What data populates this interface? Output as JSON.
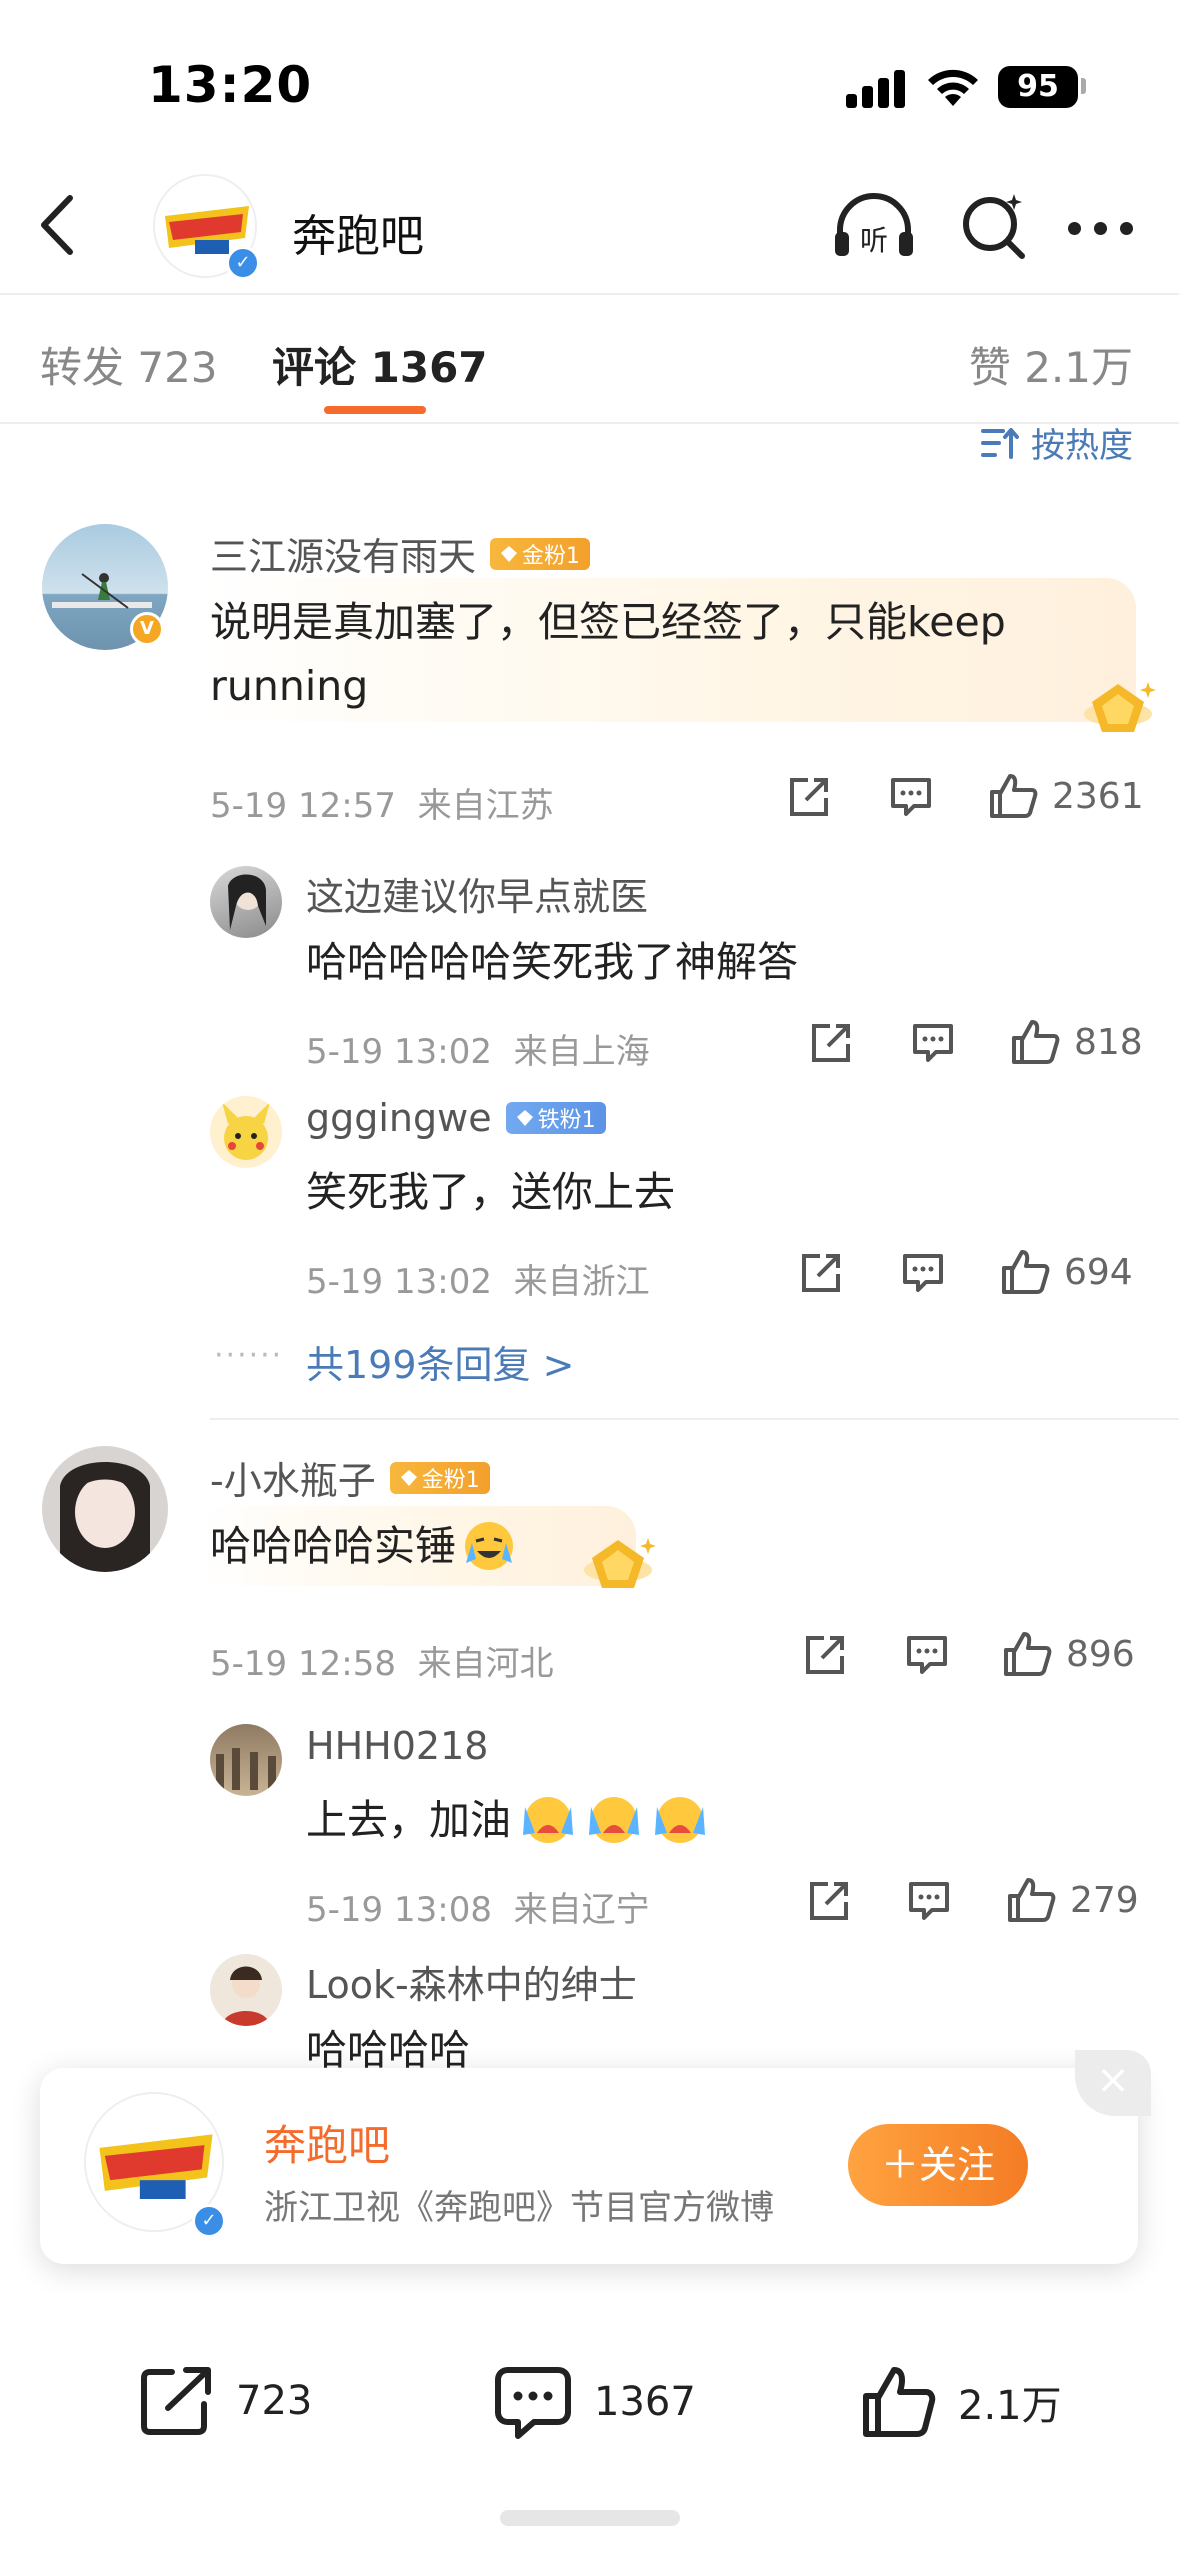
{
  "status": {
    "time": "13:20",
    "battery": "95"
  },
  "nav": {
    "title": "奔跑吧",
    "avatar_text": "奔跑吧"
  },
  "tabs": {
    "repost": "转发 723",
    "comments": "评论 1367",
    "likes": "赞 2.1万"
  },
  "sort": {
    "label": "按热度"
  },
  "comments": [
    {
      "user": "三江源没有雨天",
      "badge": "金粉1",
      "text_line1": "说明是真加塞了，但签已经签了，只能keep",
      "text_line2": "running",
      "time": "5-19 12:57",
      "location": "来自江苏",
      "likes": "2361",
      "replies": [
        {
          "user": "这边建议你早点就医",
          "text": "哈哈哈哈哈笑死我了神解答",
          "time": "5-19 13:02",
          "location": "来自上海",
          "likes": "818"
        },
        {
          "user": "gggingwe",
          "badge": "铁粉1",
          "text": "笑死我了，送你上去",
          "time": "5-19 13:02",
          "location": "来自浙江",
          "likes": "694"
        }
      ],
      "more_replies": "共199条回复 >"
    },
    {
      "user": "-小水瓶子",
      "badge": "金粉1",
      "text": "哈哈哈哈实锤",
      "time": "5-19 12:58",
      "location": "来自河北",
      "likes": "896",
      "replies": [
        {
          "user": "HHH0218",
          "text": "上去，加油",
          "time": "5-19 13:08",
          "location": "来自辽宁",
          "likes": "279"
        },
        {
          "user": "Look-森林中的绅士",
          "text": "哈哈哈哈"
        }
      ]
    }
  ],
  "follow_card": {
    "name": "奔跑吧",
    "desc": "浙江卫视《奔跑吧》节目官方微博",
    "button": "＋关注",
    "close": "×"
  },
  "bottom": {
    "repost": "723",
    "comment": "1367",
    "like": "2.1万"
  },
  "colors": {
    "accent": "#f46b2c",
    "link": "#4a7bb7",
    "gold_badge": "#f5a623",
    "iron_badge": "#5d93e6"
  },
  "icons": [
    "back-icon",
    "listen-icon",
    "search-icon",
    "more-icon",
    "sort-icon",
    "share-icon",
    "comment-icon",
    "like-icon",
    "close-icon"
  ]
}
